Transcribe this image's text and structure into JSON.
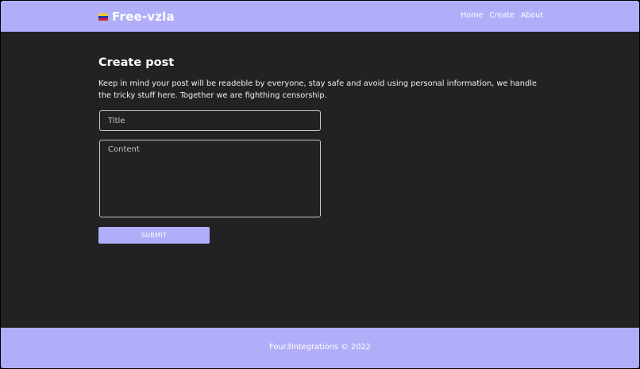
{
  "header": {
    "brand": "Free-vzla",
    "brand_icon": "venezuela-flag-icon",
    "nav": [
      {
        "label": "Home"
      },
      {
        "label": "Create"
      },
      {
        "label": "About"
      }
    ]
  },
  "main": {
    "title": "Create post",
    "intro": "Keep in mind your post will be readeble by everyone, stay safe and avoid using personal information, we handle the tricky stuff here. Together we are fighthing censorship.",
    "title_placeholder": "Title",
    "title_value": "",
    "content_placeholder": "Content",
    "content_value": "",
    "submit_label": "SUBMIT"
  },
  "footer": {
    "text": "Four3Integrations © 2022"
  },
  "colors": {
    "accent": "#b1aef9",
    "background": "#222222"
  }
}
